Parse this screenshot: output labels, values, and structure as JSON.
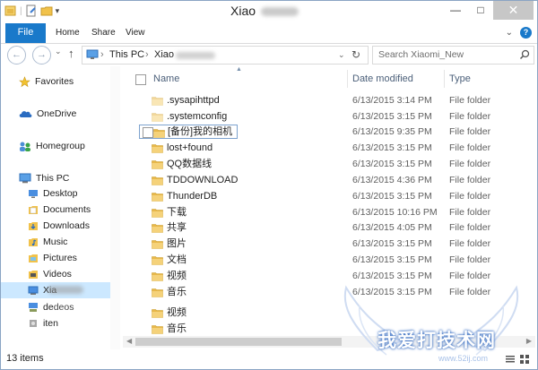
{
  "window": {
    "title": "Xiao",
    "buttons": {
      "minimize": "—",
      "maximize": "□",
      "close": "✕"
    }
  },
  "ribbon": {
    "tabs": [
      "File",
      "Home",
      "Share",
      "View"
    ],
    "expand": "⌄",
    "help": "?"
  },
  "address": {
    "back": "←",
    "forward": "→",
    "dropdown": "⌄",
    "up": "↑",
    "breadcrumb": [
      "This PC",
      "Xiao"
    ],
    "separator": "›",
    "refresh": "↻"
  },
  "search": {
    "placeholder": "Search Xiaomi_New"
  },
  "nav": {
    "favorites": "Favorites",
    "onedrive": "OneDrive",
    "homegroup": "Homegroup",
    "thispc": "This PC",
    "items": [
      "Desktop",
      "Documents",
      "Downloads",
      "Music",
      "Pictures",
      "Videos"
    ],
    "device": "Xia",
    "other1": "de",
    "other1_suffix": "deos",
    "other2": "iten"
  },
  "columns": {
    "name": "Name",
    "date": "Date modified",
    "type": "Type"
  },
  "files": [
    {
      "name": ".sysapihttpd",
      "date": "6/13/2015 3:14 PM",
      "type": "File folder",
      "faded": true
    },
    {
      "name": ".systemconfig",
      "date": "6/13/2015 3:15 PM",
      "type": "File folder",
      "faded": true
    },
    {
      "name": "[备份]我的相机",
      "date": "6/13/2015 9:35 PM",
      "type": "File folder",
      "faded": false
    },
    {
      "name": "lost+found",
      "date": "6/13/2015 3:15 PM",
      "type": "File folder",
      "faded": false
    },
    {
      "name": "QQ数据线",
      "date": "6/13/2015 3:15 PM",
      "type": "File folder",
      "faded": false
    },
    {
      "name": "TDDOWNLOAD",
      "date": "6/13/2015 4:36 PM",
      "type": "File folder",
      "faded": false
    },
    {
      "name": "ThunderDB",
      "date": "6/13/2015 3:15 PM",
      "type": "File folder",
      "faded": false
    },
    {
      "name": "下载",
      "date": "6/13/2015 10:16 PM",
      "type": "File folder",
      "faded": false
    },
    {
      "name": "共享",
      "date": "6/13/2015 4:05 PM",
      "type": "File folder",
      "faded": false
    },
    {
      "name": "图片",
      "date": "6/13/2015 3:15 PM",
      "type": "File folder",
      "faded": false
    },
    {
      "name": "文档",
      "date": "6/13/2015 3:15 PM",
      "type": "File folder",
      "faded": false
    },
    {
      "name": "视频",
      "date": "6/13/2015 3:15 PM",
      "type": "File folder",
      "faded": false
    },
    {
      "name": "音乐",
      "date": "6/13/2015 3:15 PM",
      "type": "File folder",
      "faded": false
    },
    {
      "name": "视频",
      "date": "",
      "type": "",
      "faded": false
    },
    {
      "name": "音乐",
      "date": "",
      "type": "",
      "faded": false
    }
  ],
  "status": {
    "count": "13 items"
  },
  "watermark": {
    "text": "我爱打技术网",
    "url": "www.52ij.com"
  },
  "colors": {
    "accent": "#1979ca",
    "folder": "#e8b84a",
    "selected": "#cce8ff"
  }
}
